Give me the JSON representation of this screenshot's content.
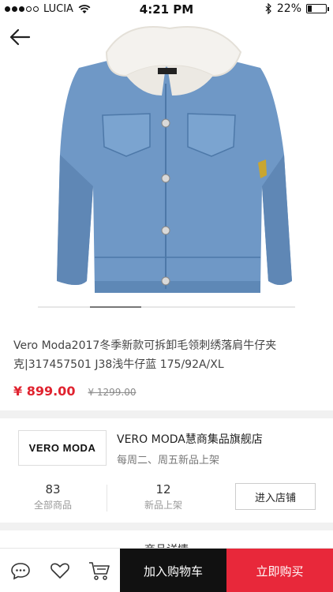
{
  "status_bar": {
    "carrier": "LUCIA",
    "time": "4:21 PM",
    "battery": "22%",
    "battery_level": 0.22
  },
  "product": {
    "title": "Vero Moda2017冬季新款可拆卸毛领刺绣落肩牛仔夹克|317457501 J38浅牛仔蓝 175/92A/XL",
    "price": "¥ 899.00",
    "original_price": "¥ 1299.00",
    "image_icon": "denim-jacket-image"
  },
  "store": {
    "logo_text": "VERO MODA",
    "name": "VERO MODA慧商集品旗舰店",
    "subtitle": "每周二、周五新品上架",
    "stats": [
      {
        "value": "83",
        "label": "全部商品"
      },
      {
        "value": "12",
        "label": "新品上架"
      }
    ],
    "enter_label": "进入店铺"
  },
  "section_title": "商品详情",
  "bottom_bar": {
    "icons": [
      "chat-icon",
      "heart-icon",
      "cart-icon"
    ],
    "add_to_cart": "加入购物车",
    "buy_now": "立即购买"
  },
  "colors": {
    "accent_red": "#e8283a",
    "price_red": "#e0232f",
    "dark": "#111111"
  }
}
